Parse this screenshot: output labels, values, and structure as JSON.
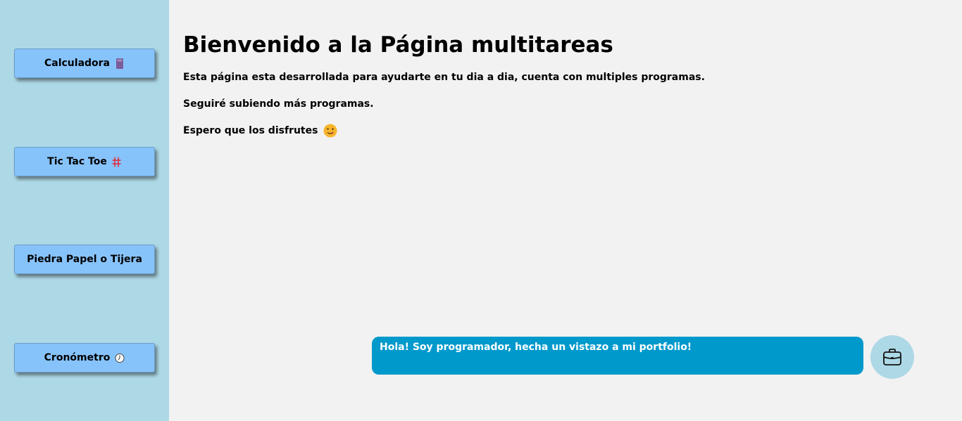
{
  "sidebar": {
    "items": [
      {
        "label": "Calculadora",
        "icon": "calculator-icon"
      },
      {
        "label": "Tic Tac Toe",
        "icon": "hash-icon"
      },
      {
        "label": "Piedra Papel o Tijera",
        "icon": ""
      },
      {
        "label": "Cronómetro",
        "icon": "stopwatch-icon"
      }
    ],
    "background": "#add8e6",
    "button_color": "#87c3fb"
  },
  "main": {
    "title": "Bienvenido a la Página multitareas",
    "paragraphs": [
      "Esta página esta desarrollada para ayudarte en tu dia a dia, cuenta con multiples programas.",
      "Seguiré subiendo más programas.",
      "Espero que los disfrutes"
    ],
    "emoji_icon": "winking-face-icon"
  },
  "chat": {
    "message": "Hola! Soy programador, hecha un vistazo a mi portfolio!",
    "bubble_color": "#0099cc",
    "button_icon": "briefcase-icon"
  }
}
